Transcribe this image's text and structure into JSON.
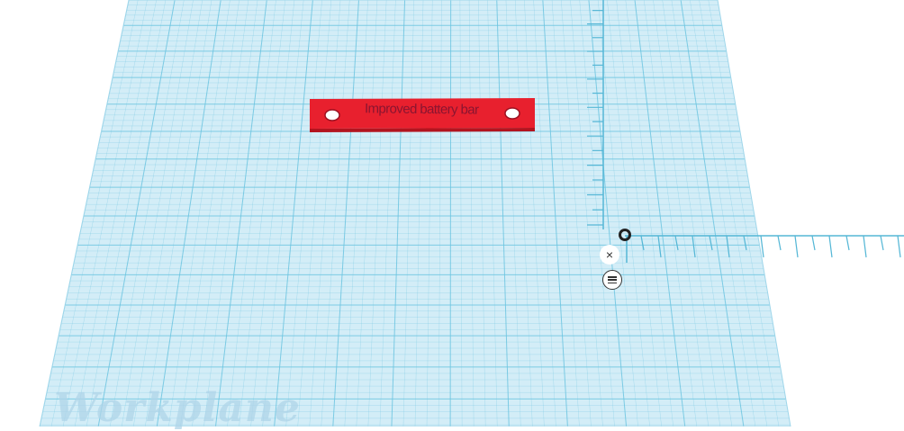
{
  "workplane": {
    "label": "Workplane",
    "grid_color": "#6cc4e0",
    "plane_fill": "#d3edf7"
  },
  "part": {
    "engraved_text": "Improved battery bar",
    "color": "#e8202e"
  },
  "ruler": {
    "close_icon": "close-icon",
    "close_glyph": "×",
    "menu_icon": "menu-icon",
    "tick_color": "#55b7d6"
  }
}
